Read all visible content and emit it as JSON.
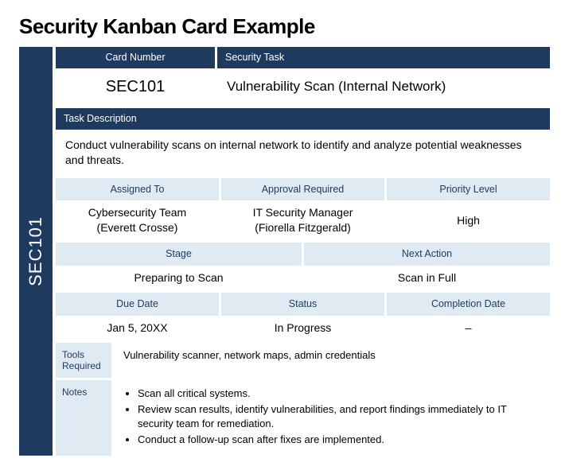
{
  "title": "Security Kanban Card Example",
  "side_tab": "SEC101",
  "header": {
    "card_number_label": "Card Number",
    "security_task_label": "Security Task",
    "card_number": "SEC101",
    "security_task": "Vulnerability Scan (Internal Network)"
  },
  "description": {
    "label": "Task Description",
    "value": "Conduct vulnerability scans on internal network to identify and analyze potential weaknesses and threats."
  },
  "assignment": {
    "assigned_to_label": "Assigned To",
    "approval_label": "Approval Required",
    "priority_label": "Priority Level",
    "assigned_to_line1": "Cybersecurity Team",
    "assigned_to_line2": "(Everett Crosse)",
    "approval_line1": "IT Security Manager",
    "approval_line2": "(Fiorella Fitzgerald)",
    "priority": "High"
  },
  "progress": {
    "stage_label": "Stage",
    "next_label": "Next Action",
    "stage": "Preparing to Scan",
    "next": "Scan in Full"
  },
  "dates": {
    "due_label": "Due Date",
    "status_label": "Status",
    "completion_label": "Completion Date",
    "due": "Jan 5, 20XX",
    "status": "In Progress",
    "completion": "–"
  },
  "tools": {
    "label": "Tools Required",
    "value": "Vulnerability scanner, network maps, admin credentials"
  },
  "notes": {
    "label": "Notes",
    "items": [
      "Scan all critical systems.",
      "Review scan results, identify vulnerabilities, and report findings immediately to IT security team for remediation.",
      "Conduct a follow-up scan after fixes are implemented."
    ]
  }
}
